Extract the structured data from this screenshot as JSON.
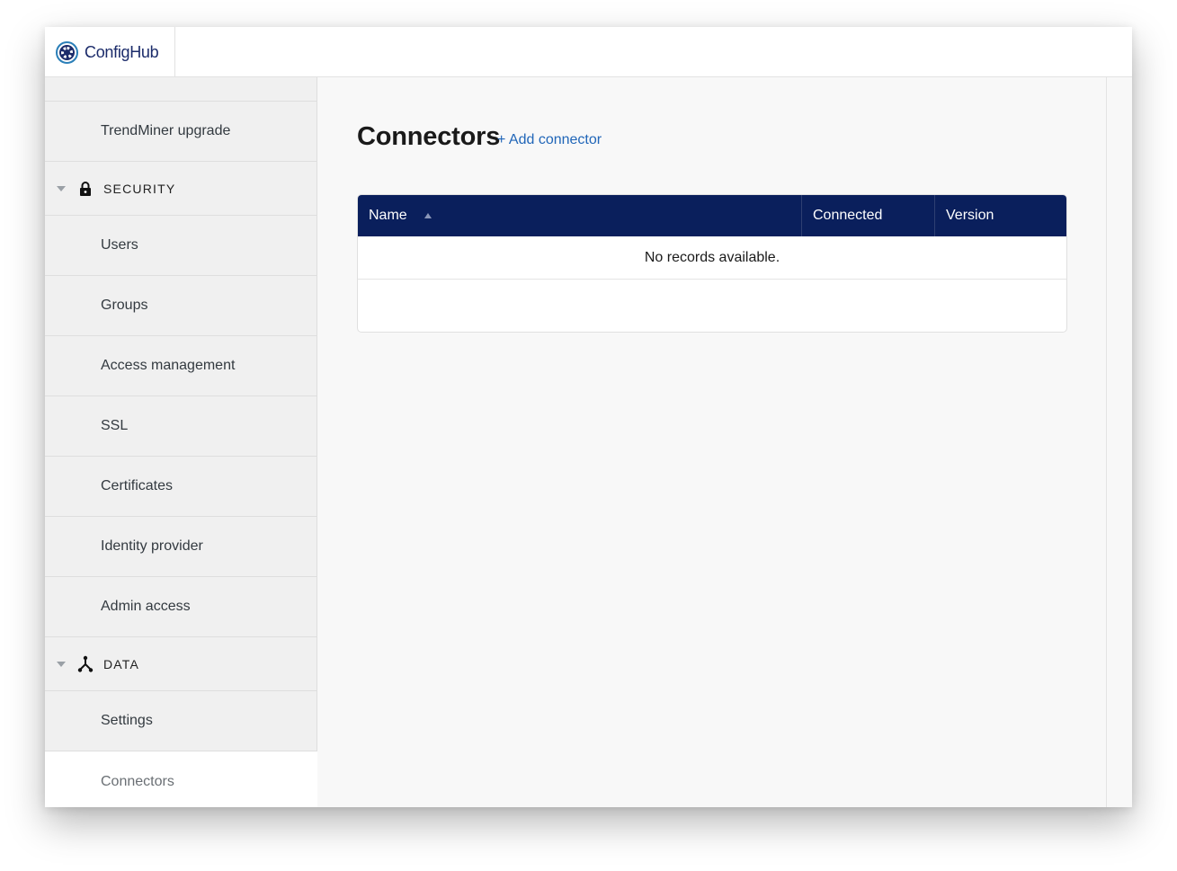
{
  "app": {
    "brand_name": "ConfigHub",
    "logo_icon": "gear-icon"
  },
  "sidebar": {
    "items": [
      {
        "label": "TrendMiner upgrade"
      },
      {
        "label": "Users"
      },
      {
        "label": "Groups"
      },
      {
        "label": "Access management"
      },
      {
        "label": "SSL"
      },
      {
        "label": "Certificates"
      },
      {
        "label": "Identity provider"
      },
      {
        "label": "Admin access"
      },
      {
        "label": "Settings"
      },
      {
        "label": "Connectors"
      }
    ],
    "sections": [
      {
        "label": "SECURITY",
        "icon": "lock-icon"
      },
      {
        "label": "DATA",
        "icon": "data-flow-icon"
      }
    ],
    "active_item": "Connectors"
  },
  "main": {
    "title": "Connectors",
    "add_link": "+ Add connector",
    "table": {
      "columns": [
        {
          "label": "Name",
          "sorted": "ascending"
        },
        {
          "label": "Connected"
        },
        {
          "label": "Version"
        }
      ],
      "empty_message": "No records available."
    }
  },
  "colors": {
    "header_bg": "#0a1f5c",
    "link": "#2166b8",
    "sidebar_bg": "#f0f0f0",
    "brand": "#1b2b6a"
  }
}
